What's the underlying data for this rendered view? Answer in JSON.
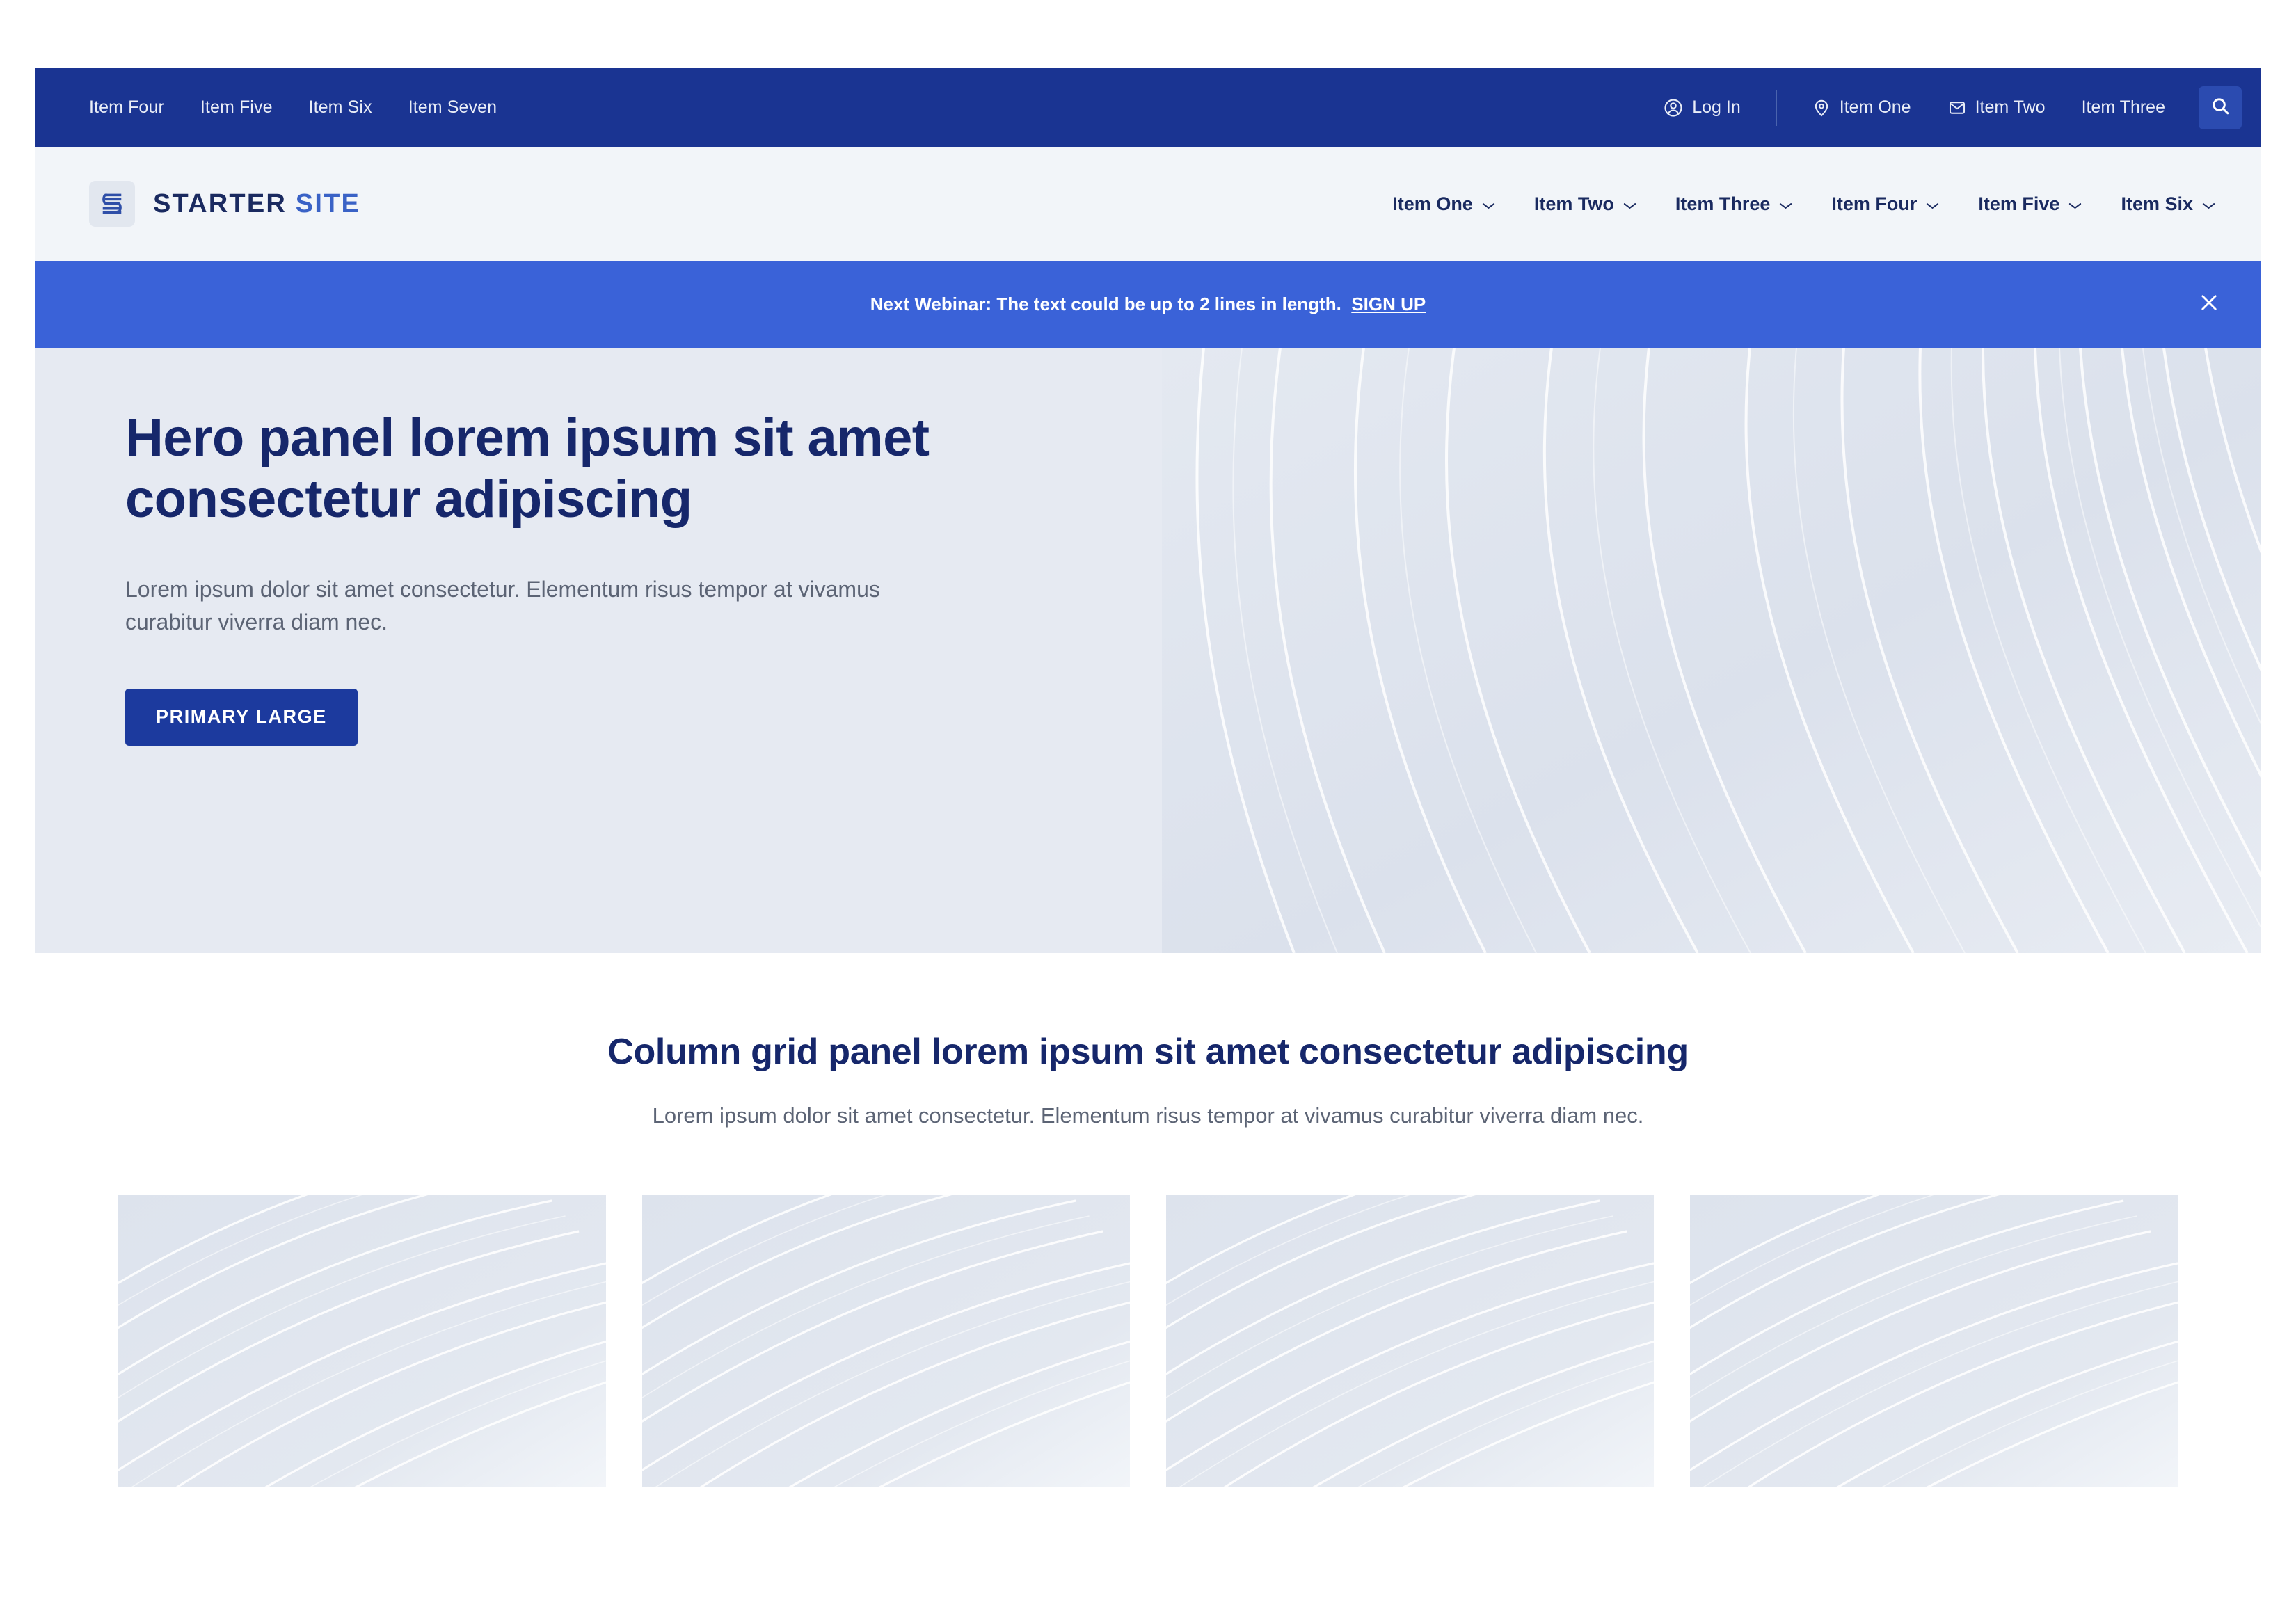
{
  "colors": {
    "utility_bar_bg": "#1a3492",
    "header_bg": "#f2f5f9",
    "announce_bg": "#3a62d8",
    "hero_bg": "#e6eaf2",
    "primary_button": "#1c3a9e",
    "heading_navy": "#16276b",
    "brand_light_blue": "#3a62c6",
    "body_text": "#5c6475",
    "image_placeholder": "#dde3ed"
  },
  "utility_bar": {
    "left_links": [
      {
        "label": "Item Four"
      },
      {
        "label": "Item Five"
      },
      {
        "label": "Item Six"
      },
      {
        "label": "Item Seven"
      }
    ],
    "login": {
      "label": "Log In",
      "icon": "user-circle-icon"
    },
    "right_items": [
      {
        "label": "Item One",
        "icon": "map-pin-icon"
      },
      {
        "label": "Item Two",
        "icon": "envelope-icon"
      },
      {
        "label": "Item Three",
        "icon": ""
      }
    ],
    "search_icon": "search-icon"
  },
  "header": {
    "brand": {
      "mark_icon": "s-logo-icon",
      "name_primary": "STARTER",
      "name_secondary": "SITE"
    },
    "nav": [
      {
        "label": "Item One",
        "icon": "chevron-down-icon"
      },
      {
        "label": "Item Two",
        "icon": "chevron-down-icon"
      },
      {
        "label": "Item Three",
        "icon": "chevron-down-icon"
      },
      {
        "label": "Item Four",
        "icon": "chevron-down-icon"
      },
      {
        "label": "Item Five",
        "icon": "chevron-down-icon"
      },
      {
        "label": "Item Six",
        "icon": "chevron-down-icon"
      }
    ]
  },
  "announcement": {
    "message": "Next Webinar: The text could be up to 2 lines in length.",
    "cta_label": "SIGN UP",
    "close_icon": "close-icon"
  },
  "hero": {
    "title": "Hero panel lorem ipsum sit amet consectetur adipiscing",
    "subtitle": "Lorem ipsum dolor sit amet consectetur. Elementum risus tempor at vivamus curabitur viverra diam nec.",
    "button_label": "PRIMARY LARGE",
    "image_alt": "wave-pattern-image"
  },
  "column_grid": {
    "title": "Column grid panel lorem ipsum sit amet consectetur adipiscing",
    "subtitle": "Lorem ipsum dolor sit amet consectetur. Elementum risus tempor at vivamus curabitur viverra diam nec.",
    "cards": [
      {
        "image_alt": "wave-pattern-image"
      },
      {
        "image_alt": "wave-pattern-image"
      },
      {
        "image_alt": "wave-pattern-image"
      },
      {
        "image_alt": "wave-pattern-image"
      }
    ]
  }
}
